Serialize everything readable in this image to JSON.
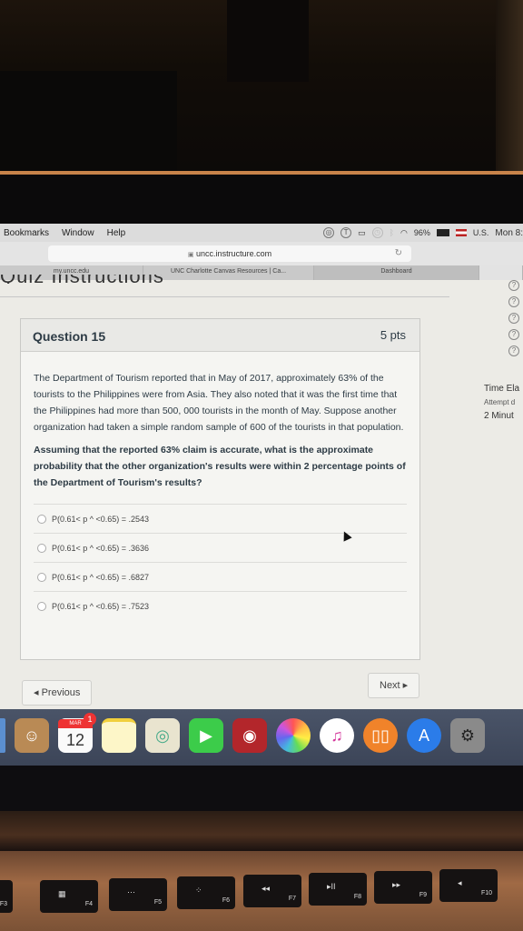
{
  "menubar": {
    "items": [
      "Bookmarks",
      "Window",
      "Help"
    ],
    "battery": "96%",
    "input_source": "U.S.",
    "clock": "Mon 8:"
  },
  "browser": {
    "url": "uncc.instructure.com",
    "reload_icon": "↻",
    "lock_icon": "🔒",
    "tabs": [
      {
        "label": "my.uncc.edu"
      },
      {
        "label": "UNC Charlotte Canvas Resources | Ca..."
      },
      {
        "label": "Dashboard"
      },
      {
        "label": ""
      }
    ]
  },
  "page": {
    "heading_partial": "Quiz Instructions",
    "question": {
      "title": "Question 15",
      "points": "5 pts",
      "paragraph": "The Department of Tourism reported that in May of 2017, approximately 63% of the tourists to the Philippines were from Asia. They also noted that it was the first time that the Philippines had more than 500, 000 tourists in the month of May. Suppose another organization had taken a simple random sample of 600 of the tourists in that population.",
      "prompt": "Assuming that the reported 63% claim is accurate, what is the approximate probability that the other organization's results were within 2 percentage points of the Department of Tourism's results?",
      "answers": [
        {
          "label": "P(0.61< p ^  <0.65) = .2543"
        },
        {
          "label": "P(0.61< p ^  <0.65) = .3636"
        },
        {
          "label": "P(0.61< p ^  <0.65) = .6827"
        },
        {
          "label": "P(0.61< p ^  <0.65) = .7523"
        }
      ]
    },
    "nav": {
      "previous": "◂ Previous",
      "next": "Next ▸"
    },
    "sidebar": {
      "help_icons": [
        "?",
        "?",
        "?",
        "?",
        "?"
      ],
      "time_label": "Time Ela",
      "attempt_label": "Attempt d",
      "time_value": "2 Minut"
    }
  },
  "dock": {
    "calendar_month": "MAR",
    "calendar_day": "12",
    "calendar_badge": "1",
    "apps": [
      "mail",
      "contacts",
      "calendar",
      "notes",
      "maps",
      "facetime",
      "photo-booth",
      "photos",
      "itunes",
      "ibooks",
      "app-store",
      "system-preferences"
    ]
  },
  "keyboard": {
    "keys": [
      {
        "fn": "F3",
        "glyph": "▢"
      },
      {
        "fn": "F4",
        "glyph": "▦"
      },
      {
        "fn": "F5",
        "glyph": "⋯"
      },
      {
        "fn": "F6",
        "glyph": "⁘"
      },
      {
        "fn": "F7",
        "glyph": "◂◂"
      },
      {
        "fn": "F8",
        "glyph": "▸II"
      },
      {
        "fn": "F9",
        "glyph": "▸▸"
      },
      {
        "fn": "F10",
        "glyph": "◂"
      }
    ]
  }
}
